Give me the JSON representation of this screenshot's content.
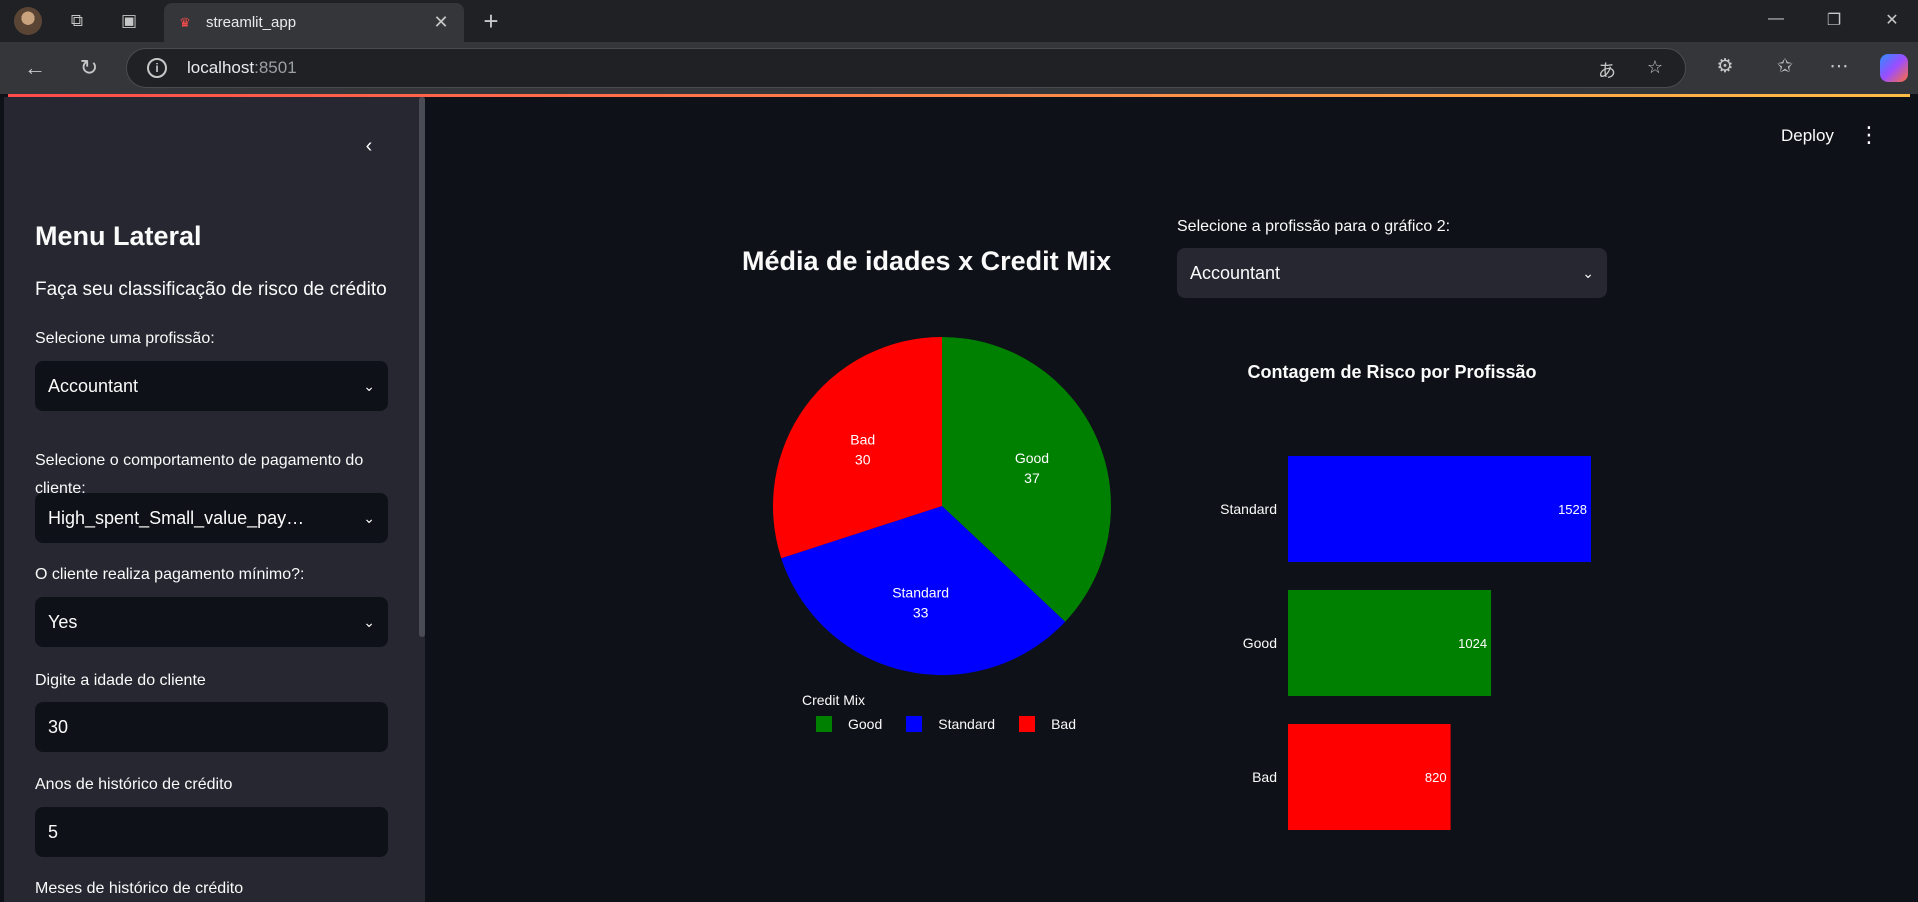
{
  "browser": {
    "tab_title": "streamlit_app",
    "url_host": "localhost",
    "url_port": ":8501"
  },
  "sidebar": {
    "title": "Menu Lateral",
    "subtitle": "Faça seu classificação de risco de crédito",
    "fields": [
      {
        "label": "Selecione uma profissão:",
        "value": "Accountant",
        "kind": "select"
      },
      {
        "label": "Selecione o comportamento de pagamento do cliente:",
        "value": "High_spent_Small_value_pay…",
        "kind": "select"
      },
      {
        "label": "O cliente realiza pagamento mínimo?:",
        "value": "Yes",
        "kind": "select"
      },
      {
        "label": "Digite a idade do cliente",
        "value": "30",
        "kind": "input"
      },
      {
        "label": "Anos de histórico de crédito",
        "value": "5",
        "kind": "input"
      },
      {
        "label": "Meses de histórico de crédito",
        "value": "",
        "kind": "input"
      }
    ]
  },
  "header": {
    "deploy_label": "Deploy"
  },
  "chart2_select": {
    "label": "Selecione a profissão para o gráfico 2:",
    "value": "Accountant"
  },
  "chart_data": [
    {
      "type": "pie",
      "title": "Média de idades x Credit Mix",
      "legend_title": "Credit Mix",
      "legend_placement": "bottom",
      "categories": [
        "Good",
        "Standard",
        "Bad"
      ],
      "values": [
        37,
        33,
        30
      ],
      "colors": [
        "#008000",
        "#0000ff",
        "#ff0000"
      ]
    },
    {
      "type": "bar",
      "orientation": "horizontal",
      "title": "Contagem de Risco por Profissão",
      "categories": [
        "Standard",
        "Good",
        "Bad"
      ],
      "values": [
        1528,
        1024,
        820
      ],
      "colors": [
        "#0000ff",
        "#008000",
        "#ff0000"
      ]
    }
  ]
}
